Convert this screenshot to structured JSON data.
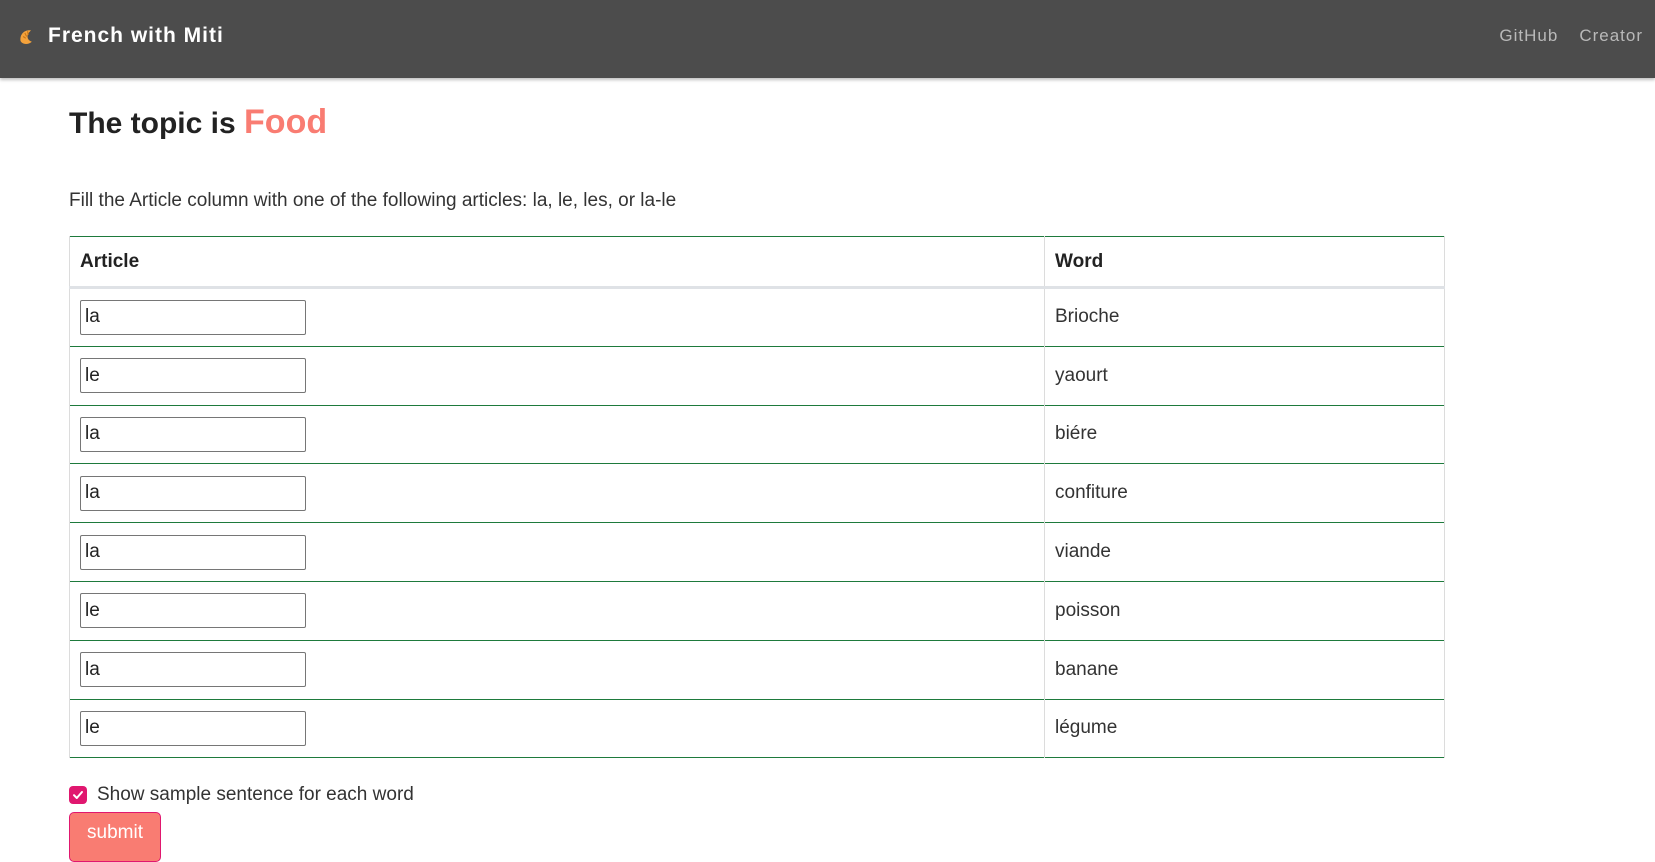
{
  "navbar": {
    "title": "French with Miti",
    "links": [
      "GitHub",
      "Creator"
    ]
  },
  "topic": {
    "prefix": "The topic is ",
    "name": "Food"
  },
  "instructions": "Fill the Article column with one of the following articles: la, le, les, or la-le",
  "table": {
    "headers": [
      "Article",
      "Word"
    ],
    "rows": [
      {
        "article": "la",
        "word": "Brioche"
      },
      {
        "article": "le",
        "word": "yaourt"
      },
      {
        "article": "la",
        "word": "biére"
      },
      {
        "article": "la",
        "word": "confiture"
      },
      {
        "article": "la",
        "word": "viande"
      },
      {
        "article": "le",
        "word": "poisson"
      },
      {
        "article": "la",
        "word": "banane"
      },
      {
        "article": "le",
        "word": "légume"
      }
    ]
  },
  "sample_sentence": {
    "label": "Show sample sentence for each word",
    "checked": true
  },
  "submit_label": "submit",
  "colors": {
    "navbar_bg": "#4c4c4c",
    "accent": "#f97c72",
    "checkbox": "#e0176f",
    "row_border": "#1e7a3c"
  },
  "icons": {
    "brand": "croissant-icon",
    "checkbox": "checkmark-icon"
  }
}
